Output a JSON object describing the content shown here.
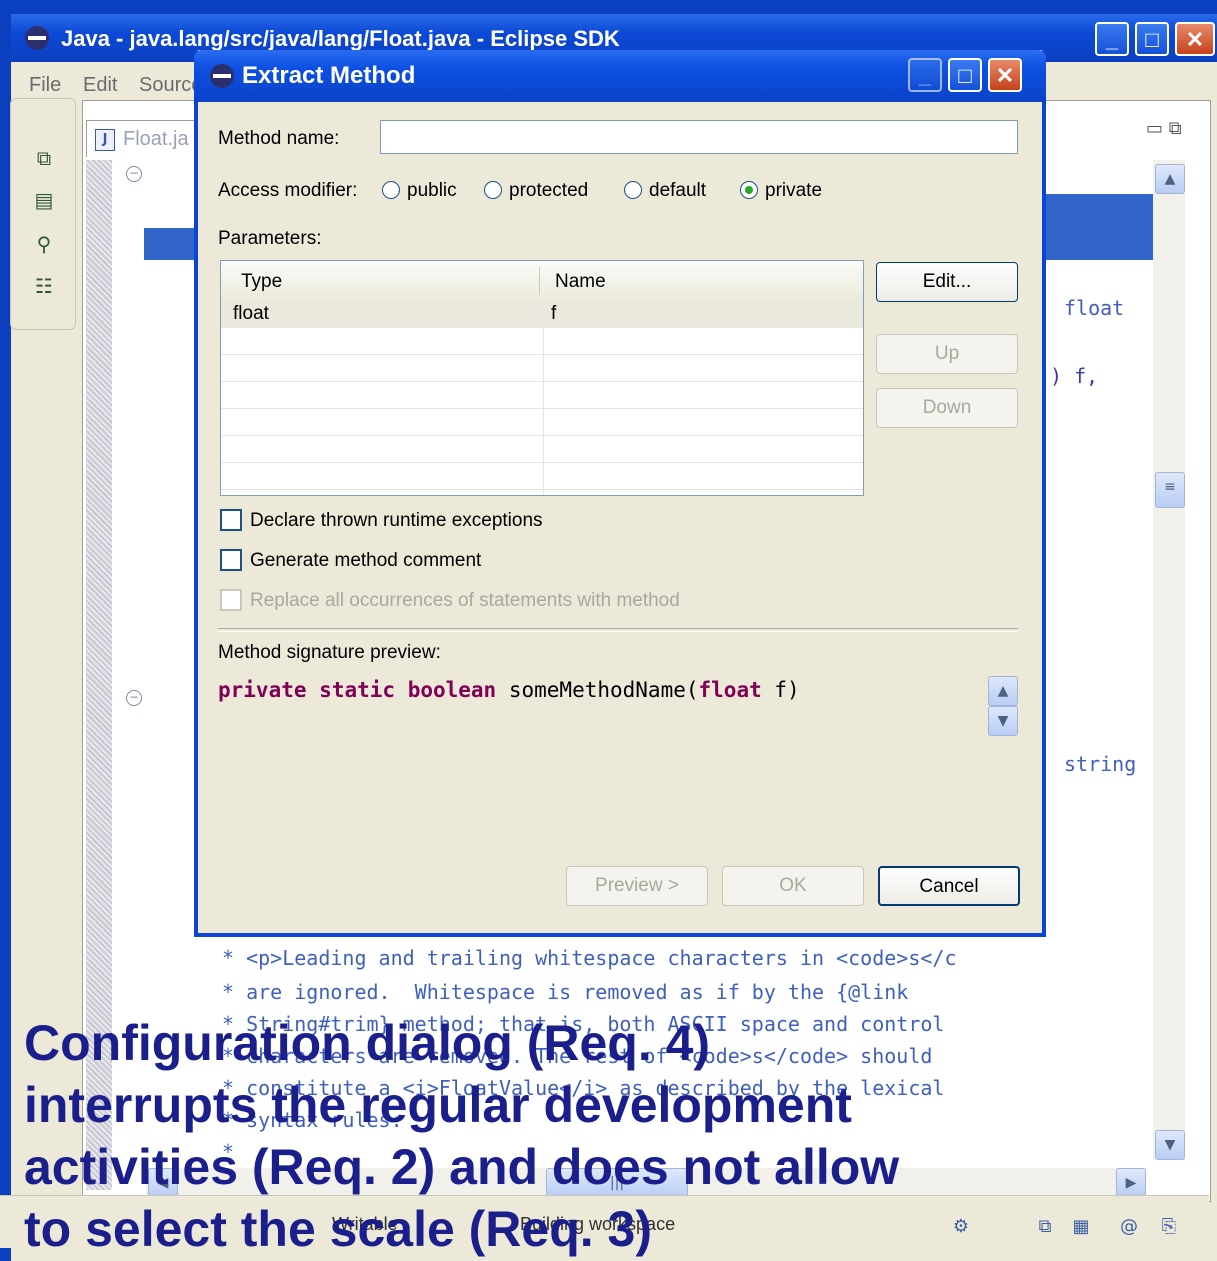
{
  "window": {
    "title": "Java - java.lang/src/java/lang/Float.java - Eclipse SDK",
    "menus": [
      "File",
      "Edit",
      "Source"
    ]
  },
  "editor": {
    "tab_label": "Float.ja",
    "code_right": [
      "float",
      ") f,",
      "string"
    ],
    "javadoc_lines": [
      "* <p>Leading and trailing whitespace characters in <code>s</c",
      "* are ignored.  Whitespace is removed as if by the {@link",
      "* String#trim} method; that is, both ASCII space and control",
      "* characters are removed. The rest of <code>s</code> should",
      "* constitute a <i>FloatValue</i> as described by the lexical",
      "* syntax rules:",
      "*"
    ]
  },
  "status": {
    "writable": "Writable",
    "building": "Building workspace"
  },
  "dialog": {
    "title": "Extract Method",
    "method_name_label": "Method name:",
    "method_name_value": "",
    "access_label": "Access modifier:",
    "access_options": [
      {
        "label": "public",
        "selected": false
      },
      {
        "label": "protected",
        "selected": false
      },
      {
        "label": "default",
        "selected": false
      },
      {
        "label": "private",
        "selected": true
      }
    ],
    "parameters_label": "Parameters:",
    "table": {
      "headers": [
        "Type",
        "Name"
      ],
      "rows": [
        {
          "type": "float",
          "name": "f"
        }
      ]
    },
    "buttons": {
      "edit": "Edit...",
      "up": "Up",
      "down": "Down",
      "preview": "Preview >",
      "ok": "OK",
      "cancel": "Cancel"
    },
    "checkboxes": {
      "declare": "Declare thrown runtime exceptions",
      "comment": "Generate method comment",
      "replace": "Replace all occurrences of statements with method"
    },
    "signature_label": "Method signature preview:",
    "signature": {
      "kw1": "private",
      "kw2": "static",
      "kw3": "boolean",
      "name": "someMethodName(",
      "ptype": "float",
      "rest": " f)"
    }
  },
  "caption": {
    "line1": "Configuration dialog (Req. 4)",
    "line2": "interrupts the regular development",
    "line3": "activities (Req. 2) and does not allow",
    "line4": "to select the scale (Req. 3)"
  }
}
